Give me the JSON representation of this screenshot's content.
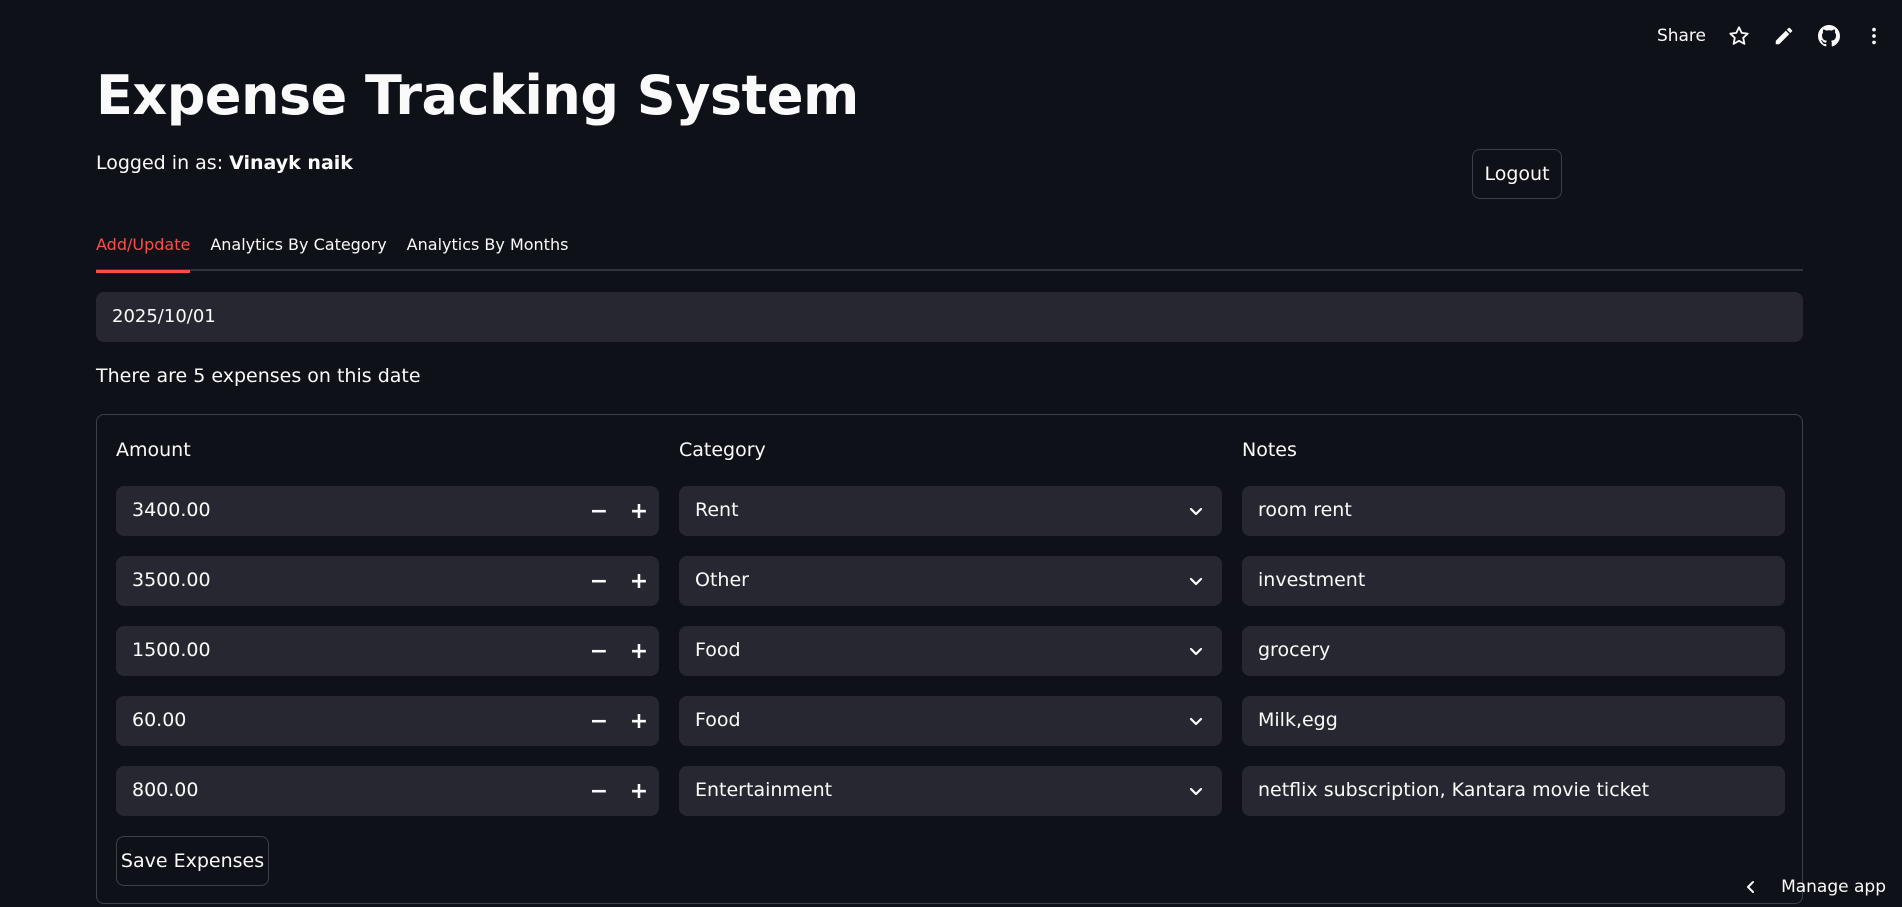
{
  "topbar": {
    "share_label": "Share",
    "icons": [
      "star-icon",
      "pencil-icon",
      "github-icon",
      "more-vertical-icon"
    ]
  },
  "app": {
    "title": "Expense Tracking System",
    "logged_in_prefix": "Logged in as: ",
    "user_name": "Vinayk naik",
    "logout_label": "Logout"
  },
  "tabs": [
    {
      "label": "Add/Update",
      "active": true
    },
    {
      "label": "Analytics By Category",
      "active": false
    },
    {
      "label": "Analytics By Months",
      "active": false
    }
  ],
  "date_input": {
    "value": "2025/10/01"
  },
  "info_text": "There are 5 expenses on this date",
  "form": {
    "headers": {
      "amount": "Amount",
      "category": "Category",
      "notes": "Notes"
    },
    "rows": [
      {
        "amount": "3400.00",
        "category": "Rent",
        "notes": "room rent"
      },
      {
        "amount": "3500.00",
        "category": "Other",
        "notes": "investment"
      },
      {
        "amount": "1500.00",
        "category": "Food",
        "notes": "grocery"
      },
      {
        "amount": "60.00",
        "category": "Food",
        "notes": "Milk,egg"
      },
      {
        "amount": "800.00",
        "category": "Entertainment",
        "notes": "netflix subscription, Kantara movie ticket"
      }
    ],
    "stepper": {
      "minus": "−",
      "plus": "+"
    },
    "save_label": "Save Expenses"
  },
  "footer": {
    "manage_label": "Manage app"
  },
  "colors": {
    "background": "#0e1117",
    "input": "#262730",
    "accent": "#ff4b4b",
    "border": "#3d4048"
  }
}
